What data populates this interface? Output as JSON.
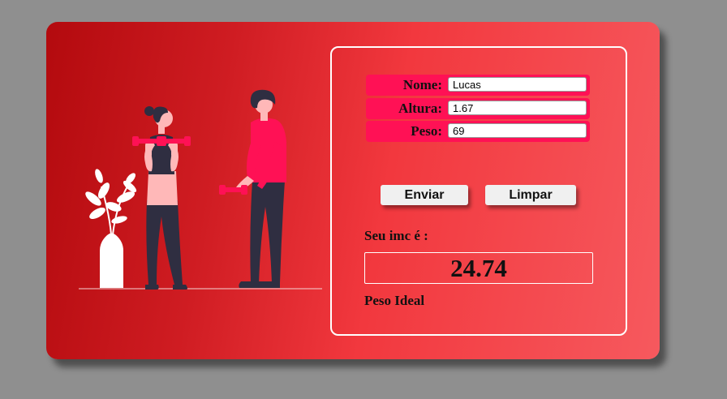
{
  "form": {
    "fields": [
      {
        "label": "Nome:",
        "value": "Lucas"
      },
      {
        "label": "Altura:",
        "value": "1.67"
      },
      {
        "label": "Peso:",
        "value": "69"
      }
    ],
    "submit_label": "Enviar",
    "clear_label": "Limpar"
  },
  "result": {
    "label": "Seu imc é :",
    "value": "24.74",
    "status": "Peso Ideal"
  },
  "colors": {
    "accent": "#ff1155",
    "card_gradient_start": "#b30a0e",
    "card_gradient_end": "#f6595e",
    "background": "#8f8f8f"
  },
  "illustration": "two-people-exercising-with-dumbbells-and-plant"
}
